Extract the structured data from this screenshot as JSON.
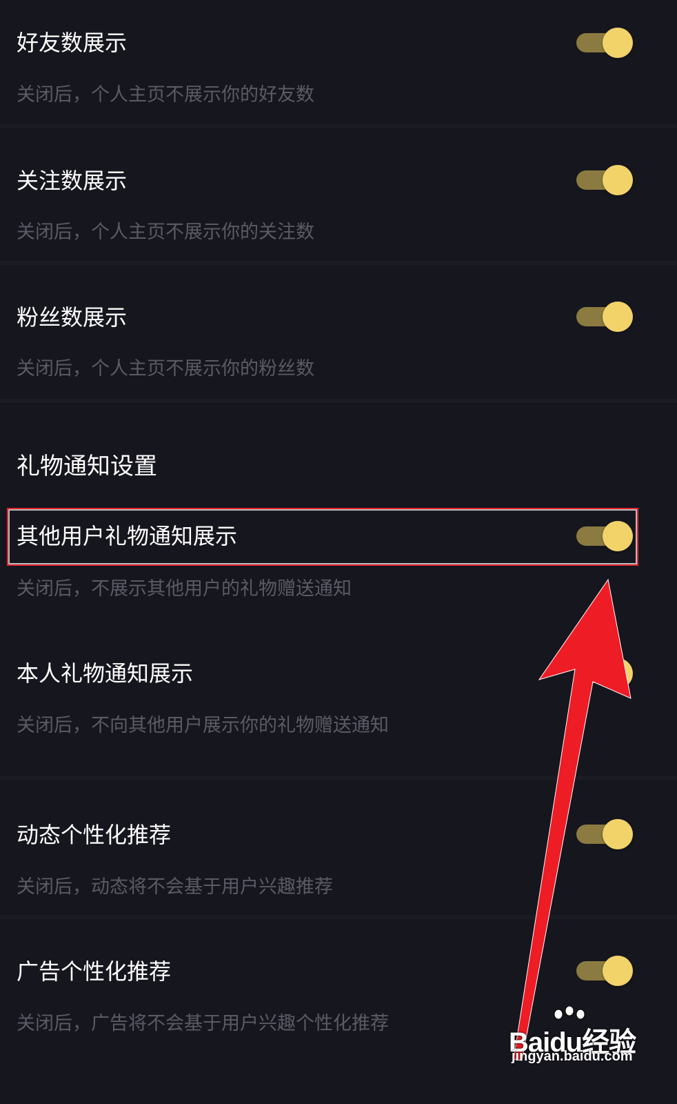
{
  "settings": {
    "friends": {
      "title": "好友数展示",
      "desc": "关闭后，个人主页不展示你的好友数",
      "on": true
    },
    "following": {
      "title": "关注数展示",
      "desc": "关闭后，个人主页不展示你的关注数",
      "on": true
    },
    "fans": {
      "title": "粉丝数展示",
      "desc": "关闭后，个人主页不展示你的粉丝数",
      "on": true
    },
    "gift_section": {
      "header": "礼物通知设置"
    },
    "other_gift": {
      "title": "其他用户礼物通知展示",
      "desc": "关闭后，不展示其他用户的礼物赠送通知",
      "on": true
    },
    "own_gift": {
      "title": "本人礼物通知展示",
      "desc": "关闭后，不向其他用户展示你的礼物赠送通知",
      "on": true
    },
    "feed_personalize": {
      "title": "动态个性化推荐",
      "desc": "关闭后，动态将不会基于用户兴趣推荐",
      "on": true
    },
    "ad_personalize": {
      "title": "广告个性化推荐",
      "desc": "关闭后，广告将不会基于用户兴趣个性化推荐",
      "on": true
    }
  },
  "colors": {
    "background": "#16161e",
    "toggle_knob": "#f2d36a",
    "toggle_track": "#8b7b40",
    "annotation_red": "#e0252a"
  },
  "watermark": {
    "logo": "Baidu经验",
    "url": "jingyan.baidu.com"
  }
}
